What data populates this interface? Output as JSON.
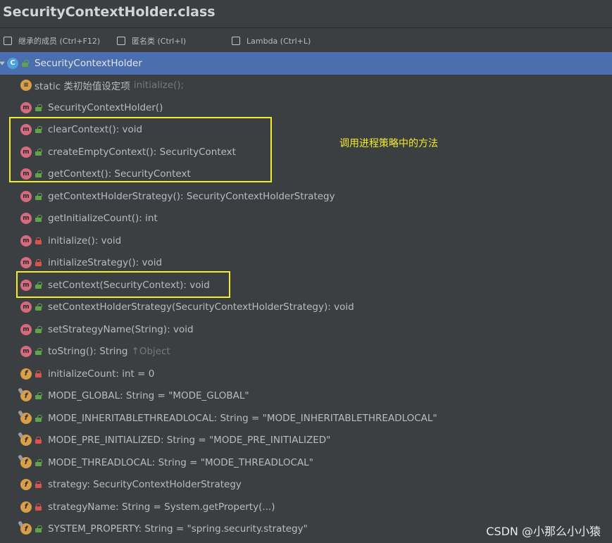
{
  "window": {
    "title": "SecurityContextHolder.class"
  },
  "options": [
    {
      "label": "继承的成员 (Ctrl+F12)",
      "checked": false
    },
    {
      "label": "匿名类 (Ctrl+I)",
      "checked": false
    },
    {
      "label": "Lambda (Ctrl+L)",
      "checked": false
    }
  ],
  "tree": {
    "root": {
      "icon": "class-icon",
      "label": "SecurityContextHolder",
      "access": "public",
      "expanded": true,
      "selected": true
    },
    "items": [
      {
        "icon": "static-initializer-icon",
        "label": "static 类初始值设定项",
        "suffix": "initialize();",
        "access": ""
      },
      {
        "icon": "method-icon",
        "label": "SecurityContextHolder()",
        "suffix": "",
        "access": "public"
      },
      {
        "icon": "method-icon",
        "label": "clearContext(): void",
        "suffix": "",
        "access": "public"
      },
      {
        "icon": "method-icon",
        "label": "createEmptyContext(): SecurityContext",
        "suffix": "",
        "access": "public"
      },
      {
        "icon": "method-icon",
        "label": "getContext(): SecurityContext",
        "suffix": "",
        "access": "public"
      },
      {
        "icon": "method-icon",
        "label": "getContextHolderStrategy(): SecurityContextHolderStrategy",
        "suffix": "",
        "access": "public"
      },
      {
        "icon": "method-icon",
        "label": "getInitializeCount(): int",
        "suffix": "",
        "access": "public"
      },
      {
        "icon": "method-icon",
        "label": "initialize(): void",
        "suffix": "",
        "access": "private"
      },
      {
        "icon": "method-icon",
        "label": "initializeStrategy(): void",
        "suffix": "",
        "access": "private"
      },
      {
        "icon": "method-icon",
        "label": "setContext(SecurityContext): void",
        "suffix": "",
        "access": "public"
      },
      {
        "icon": "method-icon",
        "label": "setContextHolderStrategy(SecurityContextHolderStrategy): void",
        "suffix": "",
        "access": "public"
      },
      {
        "icon": "method-icon",
        "label": "setStrategyName(String): void",
        "suffix": "",
        "access": "public"
      },
      {
        "icon": "method-icon",
        "label": "toString(): String",
        "suffix": "↑Object",
        "access": "public"
      },
      {
        "icon": "field-icon",
        "label": "initializeCount: int = 0",
        "suffix": "",
        "access": "private"
      },
      {
        "icon": "final-field-icon",
        "label": "MODE_GLOBAL: String = \"MODE_GLOBAL\"",
        "suffix": "",
        "access": "public"
      },
      {
        "icon": "final-field-icon",
        "label": "MODE_INHERITABLETHREADLOCAL: String = \"MODE_INHERITABLETHREADLOCAL\"",
        "suffix": "",
        "access": "public"
      },
      {
        "icon": "final-field-icon",
        "label": "MODE_PRE_INITIALIZED: String = \"MODE_PRE_INITIALIZED\"",
        "suffix": "",
        "access": "private"
      },
      {
        "icon": "final-field-icon",
        "label": "MODE_THREADLOCAL: String = \"MODE_THREADLOCAL\"",
        "suffix": "",
        "access": "public"
      },
      {
        "icon": "field-icon",
        "label": "strategy: SecurityContextHolderStrategy",
        "suffix": "",
        "access": "private"
      },
      {
        "icon": "field-icon",
        "label": "strategyName: String = System.getProperty(...)",
        "suffix": "",
        "access": "private"
      },
      {
        "icon": "final-field-icon",
        "label": "SYSTEM_PROPERTY: String = \"spring.security.strategy\"",
        "suffix": "",
        "access": "public"
      }
    ]
  },
  "annotation": {
    "text": "调用进程策略中的方法",
    "color": "#f3ec2a"
  },
  "watermark": "CSDN @小那么小小猿",
  "colors": {
    "background": "#3c3f41",
    "selection": "#4b6eaf",
    "highlight": "#f3ec2a",
    "method": "#d66a7f",
    "field": "#d89e4a",
    "class": "#4e9fd8",
    "public": "#5fa34a",
    "private": "#d9534f"
  }
}
